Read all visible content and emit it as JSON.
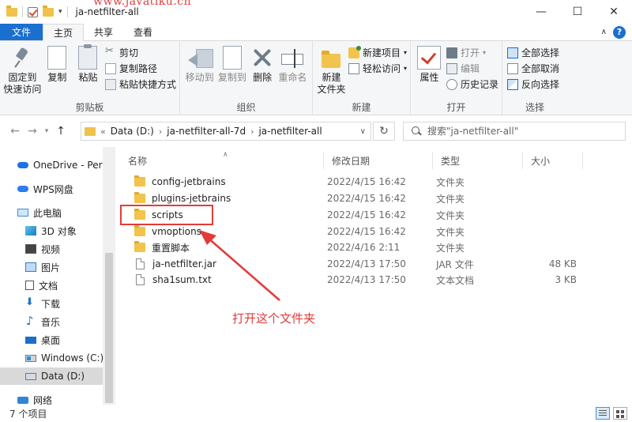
{
  "window": {
    "title": "ja-netfilter-all",
    "watermark": "www.javatiku.cn",
    "minimize": "—",
    "maximize": "☐",
    "close": "✕"
  },
  "tabs": [
    {
      "label": "文件"
    },
    {
      "label": "主页"
    },
    {
      "label": "共享"
    },
    {
      "label": "查看"
    }
  ],
  "ribbon": {
    "clipboard": {
      "label": "剪贴板",
      "pin": "固定到\n快速访问",
      "copy": "复制",
      "paste": "粘贴",
      "cut": "剪切",
      "copy_path": "复制路径",
      "paste_shortcut": "粘贴快捷方式"
    },
    "organize": {
      "label": "组织",
      "move_to": "移动到",
      "copy_to": "复制到",
      "delete": "删除",
      "rename": "重命名"
    },
    "new": {
      "label": "新建",
      "new_folder": "新建\n文件夹",
      "new_item": "新建项目",
      "easy_access": "轻松访问"
    },
    "open": {
      "label": "打开",
      "properties": "属性",
      "open": "打开",
      "edit": "编辑",
      "history": "历史记录"
    },
    "select": {
      "label": "选择",
      "select_all": "全部选择",
      "select_none": "全部取消",
      "invert": "反向选择"
    }
  },
  "address": {
    "prefix": "«",
    "crumbs": [
      "Data (D:)",
      "ja-netfilter-all-7d",
      "ja-netfilter-all"
    ],
    "separator": "›"
  },
  "search": {
    "placeholder": "搜索\"ja-netfilter-all\""
  },
  "nav": {
    "items": [
      {
        "label": "OneDrive - Pers",
        "icon": "onedrive-icon"
      },
      {
        "label": "WPS网盘",
        "icon": "wps-cloud-icon"
      },
      {
        "label": "此电脑",
        "icon": "this-pc-icon"
      },
      {
        "label": "3D 对象",
        "icon": "3d-objects-icon"
      },
      {
        "label": "视频",
        "icon": "video-icon"
      },
      {
        "label": "图片",
        "icon": "pictures-icon"
      },
      {
        "label": "文档",
        "icon": "documents-icon"
      },
      {
        "label": "下载",
        "icon": "downloads-icon"
      },
      {
        "label": "音乐",
        "icon": "music-icon"
      },
      {
        "label": "桌面",
        "icon": "desktop-icon"
      },
      {
        "label": "Windows (C:)",
        "icon": "windows-drive-icon"
      },
      {
        "label": "Data (D:)",
        "icon": "data-drive-icon"
      },
      {
        "label": "网络",
        "icon": "network-icon"
      }
    ]
  },
  "columns": {
    "name": "名称",
    "modified": "修改日期",
    "type": "类型",
    "size": "大小"
  },
  "files": [
    {
      "name": "config-jetbrains",
      "modified": "2022/4/15 16:42",
      "type": "文件夹",
      "size": "",
      "kind": "folder"
    },
    {
      "name": "plugins-jetbrains",
      "modified": "2022/4/15 16:42",
      "type": "文件夹",
      "size": "",
      "kind": "folder"
    },
    {
      "name": "scripts",
      "modified": "2022/4/15 16:42",
      "type": "文件夹",
      "size": "",
      "kind": "folder"
    },
    {
      "name": "vmoptions",
      "modified": "2022/4/15 16:42",
      "type": "文件夹",
      "size": "",
      "kind": "folder"
    },
    {
      "name": "重置脚本",
      "modified": "2022/4/16 2:11",
      "type": "文件夹",
      "size": "",
      "kind": "folder"
    },
    {
      "name": "ja-netfilter.jar",
      "modified": "2022/4/13 17:50",
      "type": "JAR 文件",
      "size": "48 KB",
      "kind": "file"
    },
    {
      "name": "sha1sum.txt",
      "modified": "2022/4/13 17:50",
      "type": "文本文档",
      "size": "3 KB",
      "kind": "file"
    }
  ],
  "annotation": {
    "text": "打开这个文件夹",
    "color": "#e23b3b"
  },
  "status": {
    "count": "7 个项目"
  }
}
